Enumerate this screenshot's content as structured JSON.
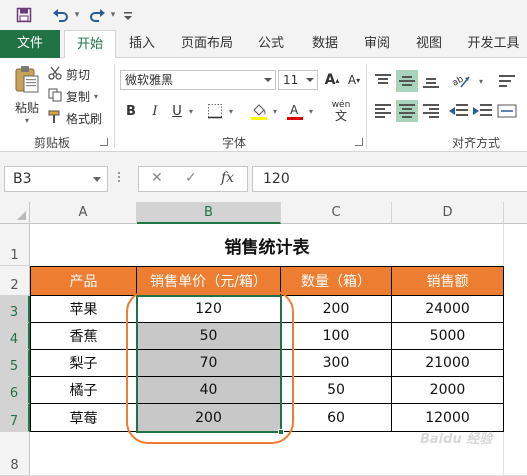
{
  "quick_access": {
    "save_icon": "save-icon",
    "undo_icon": "undo-icon",
    "redo_icon": "redo-icon",
    "customize_icon": "customize-icon"
  },
  "tabs": [
    {
      "label": "文件"
    },
    {
      "label": "开始"
    },
    {
      "label": "插入"
    },
    {
      "label": "页面布局"
    },
    {
      "label": "公式"
    },
    {
      "label": "数据"
    },
    {
      "label": "审阅"
    },
    {
      "label": "视图"
    },
    {
      "label": "开发工具"
    }
  ],
  "ribbon": {
    "clipboard": {
      "paste": "粘贴",
      "cut": "剪切",
      "copy": "复制",
      "format_painter": "格式刷",
      "group_label": "剪贴板"
    },
    "font": {
      "font_name": "微软雅黑",
      "font_size": "11",
      "bold": "B",
      "italic": "I",
      "underline": "U",
      "wen": "wén",
      "grow": "A",
      "shrink": "A",
      "group_label": "字体"
    },
    "alignment": {
      "group_label": "对齐方式"
    }
  },
  "formula_bar": {
    "name_box": "B3",
    "cancel": "✕",
    "enter": "✓",
    "fx": "fx",
    "value": "120"
  },
  "sheet": {
    "columns": [
      "A",
      "B",
      "C",
      "D"
    ],
    "rows": [
      "1",
      "2",
      "3",
      "4",
      "5",
      "6",
      "7",
      "8"
    ],
    "title": "销售统计表",
    "headers": [
      "产品",
      "销售单价（元/箱）",
      "数量（箱）",
      "销售额"
    ],
    "data": [
      [
        "苹果",
        "120",
        "200",
        "24000"
      ],
      [
        "香蕉",
        "50",
        "100",
        "5000"
      ],
      [
        "梨子",
        "70",
        "300",
        "21000"
      ],
      [
        "橘子",
        "40",
        "50",
        "2000"
      ],
      [
        "草莓",
        "200",
        "60",
        "12000"
      ]
    ]
  },
  "colors": {
    "accent": "#217346",
    "header_fill": "#ed7d31",
    "selection_fill": "#c8c8c8",
    "annotation": "#ed7d31"
  },
  "watermark": "Baidu 经验"
}
